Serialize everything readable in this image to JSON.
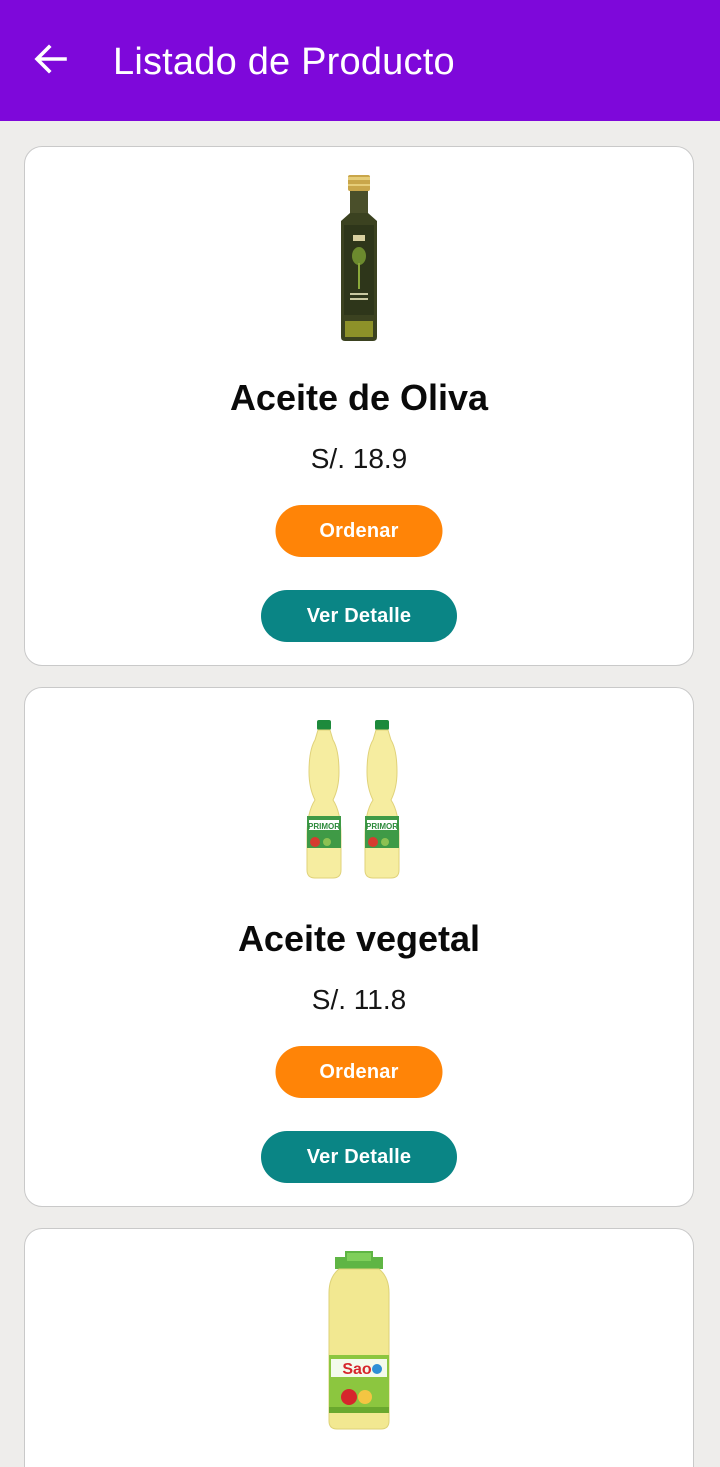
{
  "appbar": {
    "title": "Listado de Producto",
    "background": "#7e08da",
    "back_icon": "arrow-left-icon"
  },
  "products": [
    {
      "name": "Aceite de Oliva",
      "price": "S/. 18.9",
      "image": "olive-oil-bottle",
      "order_label": "Ordenar",
      "detail_label": "Ver Detalle"
    },
    {
      "name": "Aceite vegetal",
      "price": "S/. 11.8",
      "image": "vegetable-oil-bottles",
      "image_text": "PRIMOR",
      "order_label": "Ordenar",
      "detail_label": "Ver Detalle"
    },
    {
      "image": "sao-oil-bottle",
      "image_text": "Sao"
    }
  ],
  "colors": {
    "order_button": "#ff8407",
    "detail_button": "#0a8585",
    "background": "#eeedeb"
  }
}
